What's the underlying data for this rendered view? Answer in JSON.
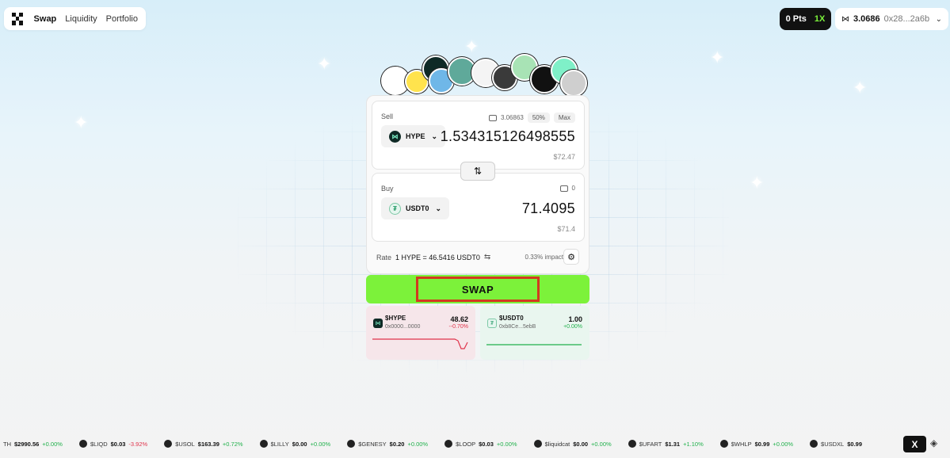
{
  "nav": {
    "items": [
      {
        "label": "Swap",
        "active": true
      },
      {
        "label": "Liquidity",
        "active": false
      },
      {
        "label": "Portfolio",
        "active": false
      }
    ]
  },
  "points": {
    "value": "0 Pts",
    "multiplier": "1X"
  },
  "wallet": {
    "balance": "3.0686",
    "address": "0x28...2a6b"
  },
  "swap": {
    "sell": {
      "label": "Sell",
      "balance": "3.06863",
      "half": "50%",
      "max": "Max",
      "token": "HYPE",
      "amount": "1.534315126498555",
      "usd": "$72.47"
    },
    "buy": {
      "label": "Buy",
      "balance": "0",
      "token": "USDT0",
      "amount": "71.4095",
      "usd": "$71.4"
    },
    "rate_label": "Rate",
    "rate_value": "1 HYPE = 46.5416 USDT0",
    "impact": "0.33% impact",
    "button": "SWAP"
  },
  "token_cards": [
    {
      "name": "$HYPE",
      "address": "0x0000...0000",
      "price": "48.62",
      "change": "--0.70%"
    },
    {
      "name": "$USDT0",
      "address": "0xb8Ce...5ebB",
      "price": "1.00",
      "change": "+0.00%"
    }
  ],
  "ticker": [
    {
      "symbol": "TH",
      "price": "$2990.56",
      "change": "+0.00%",
      "dir": "up"
    },
    {
      "symbol": "$LIQD",
      "price": "$0.03",
      "change": "-3.92%",
      "dir": "down"
    },
    {
      "symbol": "$USOL",
      "price": "$163.39",
      "change": "+0.72%",
      "dir": "up"
    },
    {
      "symbol": "$LILLY",
      "price": "$0.00",
      "change": "+0.00%",
      "dir": "up"
    },
    {
      "symbol": "$GENESY",
      "price": "$0.20",
      "change": "+0.00%",
      "dir": "up"
    },
    {
      "symbol": "$LOOP",
      "price": "$0.03",
      "change": "+0.00%",
      "dir": "up"
    },
    {
      "symbol": "$liquidcat",
      "price": "$0.00",
      "change": "+0.00%",
      "dir": "up"
    },
    {
      "symbol": "$UFART",
      "price": "$1.31",
      "change": "+1.10%",
      "dir": "up"
    },
    {
      "symbol": "$WHLP",
      "price": "$0.99",
      "change": "+0.00%",
      "dir": "up"
    },
    {
      "symbol": "$USDXL",
      "price": "$0.99",
      "change": "",
      "dir": "up"
    }
  ],
  "social": {
    "x_label": "X"
  },
  "colors": {
    "accent_green": "#7cf23a",
    "highlight_red": "#d23a1f",
    "up": "#22b14c",
    "down": "#e0334b"
  }
}
